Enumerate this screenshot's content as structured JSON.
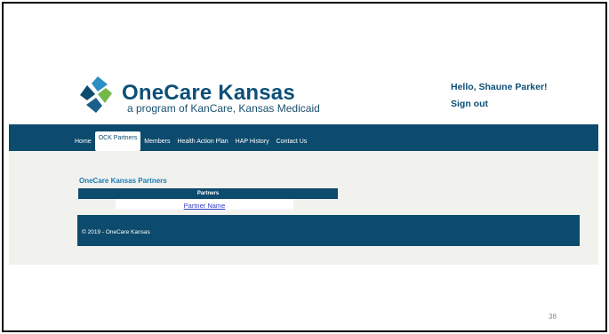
{
  "brand": {
    "title": "OneCare Kansas",
    "subtitle": "a program of KanCare, Kansas Medicaid",
    "logo_icon": "pinwheel-logo-icon",
    "colors": {
      "primary": "#0d4b6e",
      "accent_blue": "#1a7cb5",
      "accent_green": "#74b84a",
      "accent_teal": "#2b8fc4"
    }
  },
  "user": {
    "greeting": "Hello, Shaune Parker!",
    "signout_label": "Sign out"
  },
  "nav": {
    "items": [
      {
        "label": "Home"
      },
      {
        "label": "OCK Partners"
      },
      {
        "label": "Members"
      },
      {
        "label": "Health Action Plan"
      },
      {
        "label": "HAP History"
      },
      {
        "label": "Contact Us"
      }
    ],
    "active_index": 1
  },
  "main": {
    "section_title": "OneCare Kansas Partners",
    "table": {
      "header": "Partners",
      "rows": [
        {
          "name": "Partner Name"
        }
      ]
    }
  },
  "footer": {
    "text": "© 2019 - OneCare Kansas"
  },
  "slide": {
    "number": "38"
  }
}
